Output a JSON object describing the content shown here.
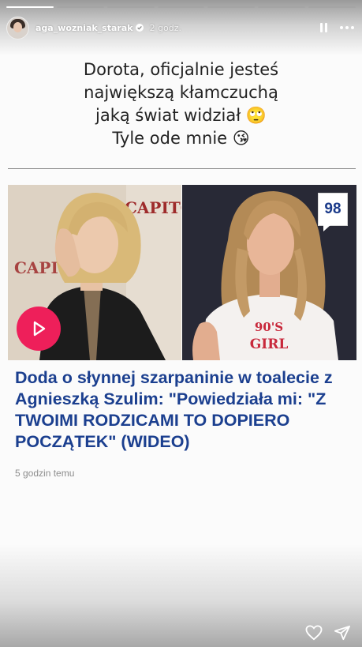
{
  "story": {
    "progress": [
      1.0,
      0.0,
      0.0,
      0.0,
      0.0,
      0.0,
      0.0
    ],
    "username": "aga_wozniak_starak",
    "verified": true,
    "time_ago": "2 godz."
  },
  "caption": {
    "line1": "Dorota, oficjalnie jesteś",
    "line2": "największą kłamczuchą",
    "line3": "jaką świat widział 🙄",
    "line4": "Tyle ode mnie 😘"
  },
  "article": {
    "score": "98",
    "bg_word_left": "CAPITOL",
    "bg_word_right": "CAPITOL",
    "tshirt_text_line1": "90'S",
    "tshirt_text_line2": "GIRL",
    "headline": "Doda o słynnej szarpaninie w toalecie z Agnieszką Szulim: \"Powiedziała mi: \"Z TWOIMI RODZICAMI TO DOPIERO POCZĄTEK\" (WIDEO)",
    "time_ago": "5 godzin temu",
    "headline_color": "#1b3f8f",
    "play_color": "#ee1f5a"
  },
  "footer": {
    "like_icon": "heart-icon",
    "share_icon": "send-icon"
  }
}
